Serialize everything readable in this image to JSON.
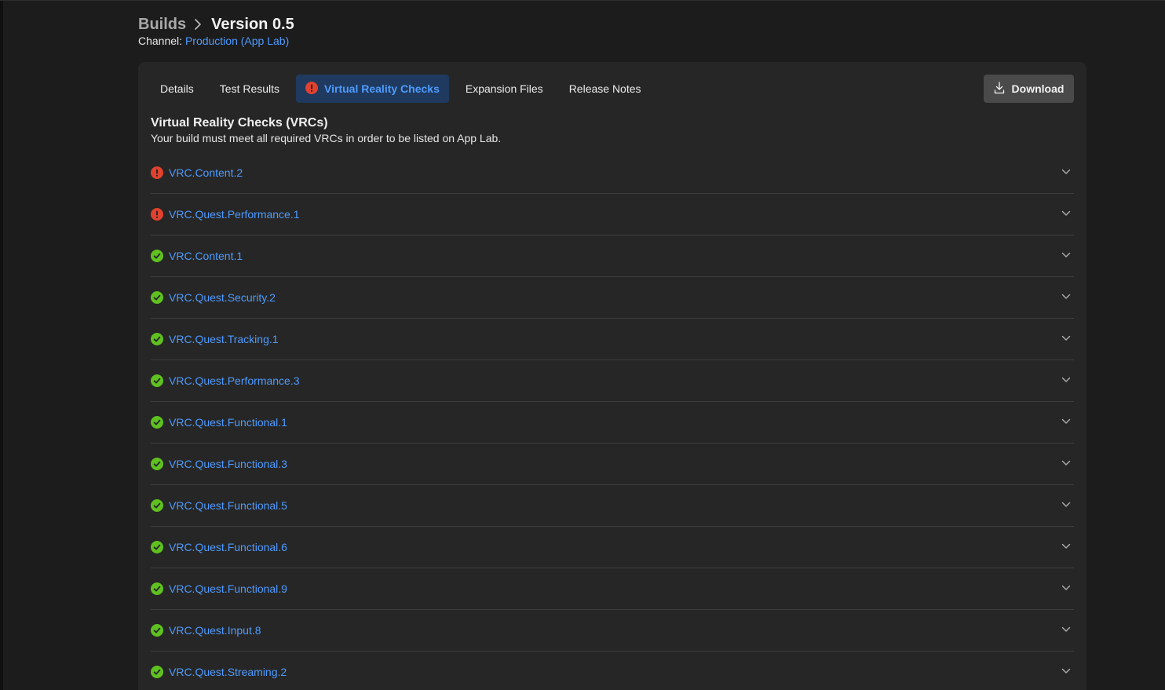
{
  "breadcrumb": {
    "parent": "Builds",
    "current": "Version 0.5"
  },
  "channel": {
    "label": "Channel:",
    "value": "Production (App Lab)"
  },
  "tabs": [
    {
      "label": "Details",
      "active": false
    },
    {
      "label": "Test Results",
      "active": false
    },
    {
      "label": "Virtual Reality Checks",
      "active": true,
      "icon": "alert-icon"
    },
    {
      "label": "Expansion Files",
      "active": false
    },
    {
      "label": "Release Notes",
      "active": false
    }
  ],
  "download": {
    "label": "Download",
    "icon": "download-icon"
  },
  "section": {
    "title": "Virtual Reality Checks (VRCs)",
    "subtitle": "Your build must meet all required VRCs in order to be listed on App Lab."
  },
  "vrcs": [
    {
      "id": "VRC.Content.2",
      "status": "fail"
    },
    {
      "id": "VRC.Quest.Performance.1",
      "status": "fail"
    },
    {
      "id": "VRC.Content.1",
      "status": "pass"
    },
    {
      "id": "VRC.Quest.Security.2",
      "status": "pass"
    },
    {
      "id": "VRC.Quest.Tracking.1",
      "status": "pass"
    },
    {
      "id": "VRC.Quest.Performance.3",
      "status": "pass"
    },
    {
      "id": "VRC.Quest.Functional.1",
      "status": "pass"
    },
    {
      "id": "VRC.Quest.Functional.3",
      "status": "pass"
    },
    {
      "id": "VRC.Quest.Functional.5",
      "status": "pass"
    },
    {
      "id": "VRC.Quest.Functional.6",
      "status": "pass"
    },
    {
      "id": "VRC.Quest.Functional.9",
      "status": "pass"
    },
    {
      "id": "VRC.Quest.Input.8",
      "status": "pass"
    },
    {
      "id": "VRC.Quest.Streaming.2",
      "status": "pass"
    }
  ],
  "colors": {
    "accent": "#4e9bff",
    "fail": "#e0422f",
    "pass": "#5fc11f",
    "background": "#1c1c1c",
    "card": "#262626"
  }
}
